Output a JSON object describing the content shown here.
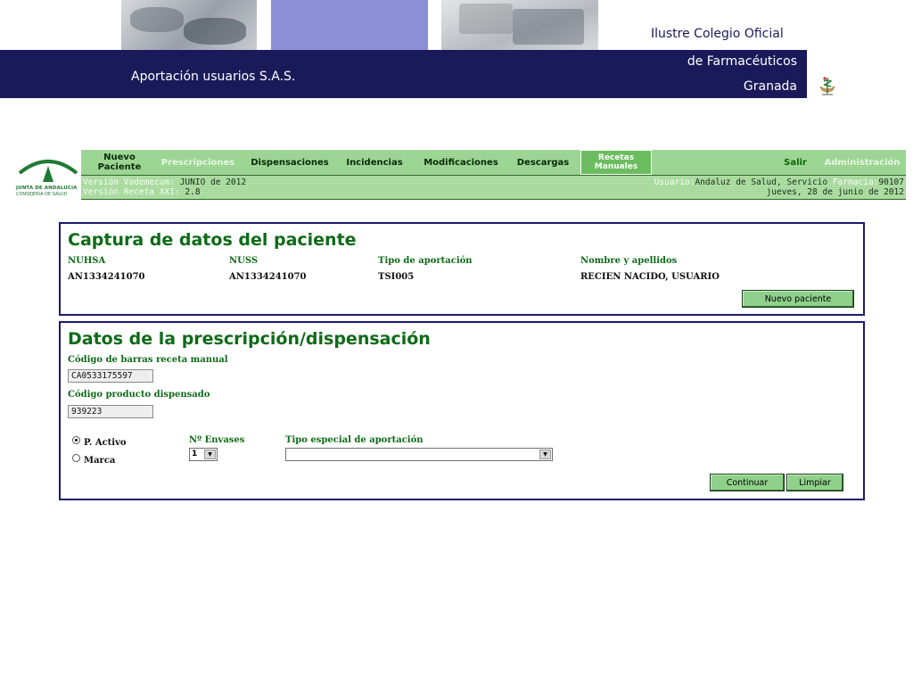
{
  "header": {
    "subtitle": "Aportación usuarios S.A.S.",
    "college_line1": "Ilustre Colegio Oficial",
    "college_line2": "de Farmacéuticos",
    "college_line3": "Granada"
  },
  "junta": {
    "line1": "JUNTA DE ANDALUCIA",
    "line2": "CONSEJERIA DE SALUD"
  },
  "nav": {
    "items": [
      {
        "label": "Nuevo\nPaciente"
      },
      {
        "label": "Prescripciones"
      },
      {
        "label": "Dispensaciones"
      },
      {
        "label": "Incidencias"
      },
      {
        "label": "Modificaciones"
      },
      {
        "label": "Descargas"
      },
      {
        "label": "Recetas\nManuales"
      },
      {
        "label": "Salir"
      },
      {
        "label": "Administración"
      }
    ]
  },
  "info": {
    "vademecum_label": "Versión Vademecum:",
    "vademecum_value": "JUNIO de 2012",
    "receta_label": "Versión Receta XXI:",
    "receta_value": "2.8",
    "usuario_label": "Usuario:",
    "usuario_value": "Andaluz de Salud, Servicio",
    "farmacia_label": "Farmacia:",
    "farmacia_value": "90107",
    "date": "jueves, 28 de junio de 2012"
  },
  "patient": {
    "title": "Captura de datos del paciente",
    "fields": [
      {
        "label": "NUHSA",
        "value": "AN1334241070"
      },
      {
        "label": "NUSS",
        "value": "AN1334241070"
      },
      {
        "label": "Tipo de aportación",
        "value": "TSI005"
      },
      {
        "label": "Nombre y apellidos",
        "value": "RECIEN NACIDO, USUARIO"
      }
    ],
    "new_button": "Nuevo paciente"
  },
  "prescription": {
    "title": "Datos de la prescripción/dispensación",
    "barcode_label": "Código de barras receta manual",
    "barcode_value": "CA0533175597",
    "product_label": "Código producto dispensado",
    "product_value": "939223",
    "radio_active": "P. Activo",
    "radio_brand": "Marca",
    "radio_selected": "P. Activo",
    "envases_label": "Nº Envases",
    "envases_value": "1",
    "tipo_label": "Tipo especial de aportación",
    "tipo_value": "",
    "continue_button": "Continuar",
    "clear_button": "Limpiar"
  },
  "icons": {
    "dropdown": "chevron-down-icon",
    "college_logo": "pharmacy-logo-icon",
    "junta_logo": "junta-andalucia-logo-icon"
  },
  "colors": {
    "brand_blue": "#1a1a5a",
    "panel_border": "#1a1a6e",
    "nav_green": "#8fcf86",
    "title_green": "#0d6b17",
    "button_green": "#8fd08a"
  }
}
